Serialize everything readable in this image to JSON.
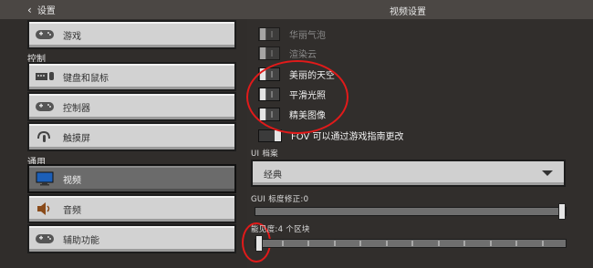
{
  "header": {
    "back_label": "设置",
    "title": "视频设置"
  },
  "sidebar": {
    "top_item": {
      "label": "游戏",
      "icon": "controller-icon"
    },
    "sections": [
      {
        "title": "控制",
        "items": [
          {
            "label": "键盘和鼠标",
            "icon": "keyboard-mouse-icon"
          },
          {
            "label": "控制器",
            "icon": "controller-icon"
          },
          {
            "label": "触摸屏",
            "icon": "touch-icon"
          }
        ]
      },
      {
        "title": "通用",
        "items": [
          {
            "label": "视频",
            "icon": "monitor-icon",
            "active": true
          },
          {
            "label": "音频",
            "icon": "speaker-icon"
          },
          {
            "label": "辅助功能",
            "icon": "controller-icon"
          }
        ]
      }
    ]
  },
  "settings": {
    "toggles": [
      {
        "label": "华丽气泡",
        "enabled": false,
        "dimmed": true
      },
      {
        "label": "渲染云",
        "enabled": false,
        "dimmed": true
      },
      {
        "label": "美丽的天空",
        "enabled": false,
        "dimmed": false
      },
      {
        "label": "平滑光照",
        "enabled": false,
        "dimmed": false
      },
      {
        "label": "精美图像",
        "enabled": false,
        "dimmed": false
      }
    ],
    "fov": {
      "label": "FOV 可以通过游戏指南更改",
      "enabled": true
    },
    "ui_profile": {
      "label": "UI 档案",
      "value": "经典"
    },
    "gui_scale": {
      "label": "GUI 标度修正:0",
      "value_fraction": 1.0
    },
    "render_distance": {
      "label": "能见度:4 个区块",
      "value_fraction": 0.0,
      "ticks": 12
    }
  },
  "colors": {
    "annotation_red": "#e11a1a"
  }
}
